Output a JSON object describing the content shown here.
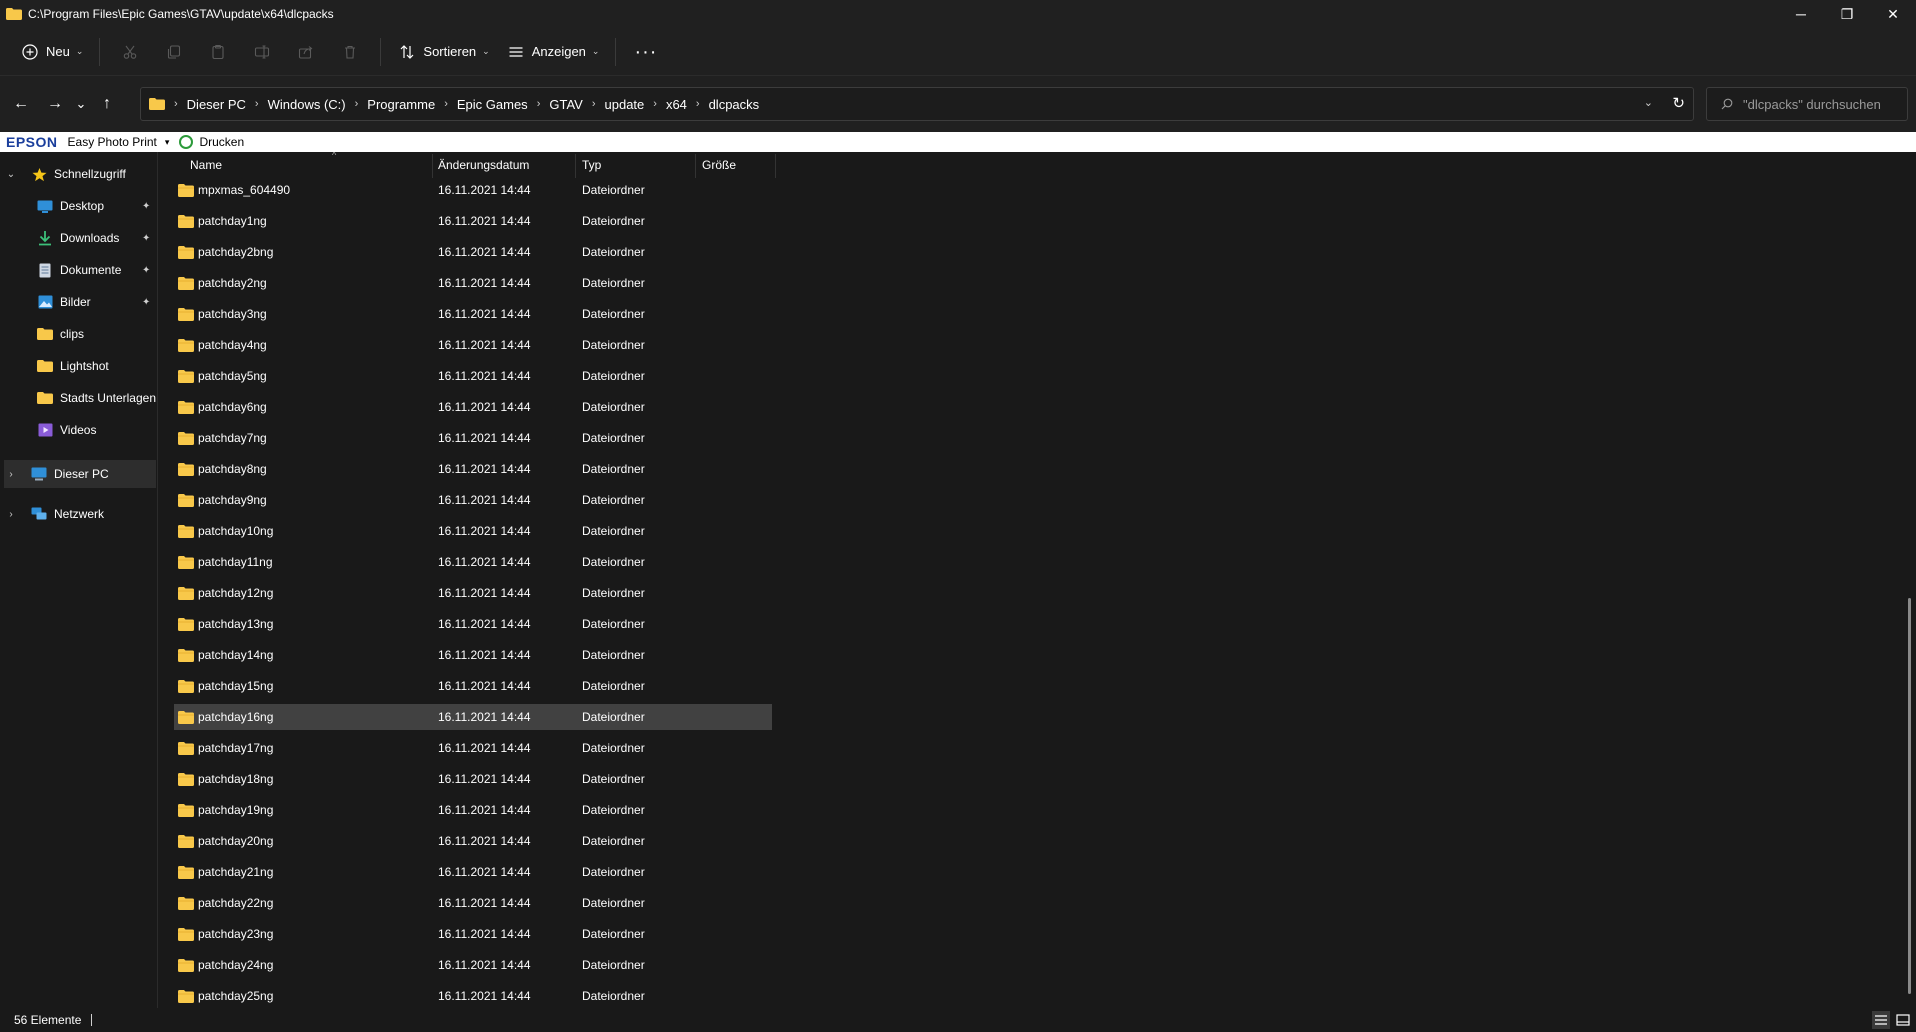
{
  "window": {
    "title": "C:\\Program Files\\Epic Games\\GTAV\\update\\x64\\dlcpacks",
    "minimize_glyph": "─",
    "restore_glyph": "❐",
    "close_glyph": "✕"
  },
  "commandbar": {
    "new_label": "Neu",
    "sort_label": "Sortieren",
    "view_label": "Anzeigen",
    "more_glyph": "···"
  },
  "nav": {
    "back_glyph": "←",
    "forward_glyph": "→",
    "recent_glyph": "⌄",
    "up_glyph": "↑"
  },
  "address": {
    "crumbs": [
      "Dieser PC",
      "Windows (C:)",
      "Programme",
      "Epic Games",
      "GTAV",
      "update",
      "x64",
      "dlcpacks"
    ],
    "separator": "›",
    "dropdown_glyph": "⌄",
    "refresh_glyph": "↻"
  },
  "search": {
    "placeholder": "\"dlcpacks\" durchsuchen"
  },
  "epson": {
    "logo": "EPSON",
    "app": "Easy Photo Print",
    "dropdown_glyph": "▾",
    "print_label": "Drucken"
  },
  "sidebar": {
    "quick_access": "Schnellzugriff",
    "items": [
      {
        "label": "Desktop",
        "icon": "desktop-icon",
        "pinned": true
      },
      {
        "label": "Downloads",
        "icon": "download-icon",
        "pinned": true
      },
      {
        "label": "Dokumente",
        "icon": "document-icon",
        "pinned": true
      },
      {
        "label": "Bilder",
        "icon": "pictures-icon",
        "pinned": true
      },
      {
        "label": "clips",
        "icon": "folder-icon",
        "pinned": false
      },
      {
        "label": "Lightshot",
        "icon": "folder-icon",
        "pinned": false
      },
      {
        "label": "Stadts Unterlagen",
        "icon": "folder-icon",
        "pinned": false
      },
      {
        "label": "Videos",
        "icon": "videos-icon",
        "pinned": false
      }
    ],
    "this_pc": "Dieser PC",
    "network": "Netzwerk",
    "pin_glyph": "📌",
    "expand_glyph": "›",
    "collapse_glyph": "⌄"
  },
  "columns": {
    "name": "Name",
    "date": "Änderungsdatum",
    "type": "Typ",
    "size": "Größe",
    "sort_glyph": "^"
  },
  "files": [
    {
      "name": "mpxmas_604490",
      "date": "16.11.2021 14:44",
      "type": "Dateiordner"
    },
    {
      "name": "patchday1ng",
      "date": "16.11.2021 14:44",
      "type": "Dateiordner"
    },
    {
      "name": "patchday2bng",
      "date": "16.11.2021 14:44",
      "type": "Dateiordner"
    },
    {
      "name": "patchday2ng",
      "date": "16.11.2021 14:44",
      "type": "Dateiordner"
    },
    {
      "name": "patchday3ng",
      "date": "16.11.2021 14:44",
      "type": "Dateiordner"
    },
    {
      "name": "patchday4ng",
      "date": "16.11.2021 14:44",
      "type": "Dateiordner"
    },
    {
      "name": "patchday5ng",
      "date": "16.11.2021 14:44",
      "type": "Dateiordner"
    },
    {
      "name": "patchday6ng",
      "date": "16.11.2021 14:44",
      "type": "Dateiordner"
    },
    {
      "name": "patchday7ng",
      "date": "16.11.2021 14:44",
      "type": "Dateiordner"
    },
    {
      "name": "patchday8ng",
      "date": "16.11.2021 14:44",
      "type": "Dateiordner"
    },
    {
      "name": "patchday9ng",
      "date": "16.11.2021 14:44",
      "type": "Dateiordner"
    },
    {
      "name": "patchday10ng",
      "date": "16.11.2021 14:44",
      "type": "Dateiordner"
    },
    {
      "name": "patchday11ng",
      "date": "16.11.2021 14:44",
      "type": "Dateiordner"
    },
    {
      "name": "patchday12ng",
      "date": "16.11.2021 14:44",
      "type": "Dateiordner"
    },
    {
      "name": "patchday13ng",
      "date": "16.11.2021 14:44",
      "type": "Dateiordner"
    },
    {
      "name": "patchday14ng",
      "date": "16.11.2021 14:44",
      "type": "Dateiordner"
    },
    {
      "name": "patchday15ng",
      "date": "16.11.2021 14:44",
      "type": "Dateiordner"
    },
    {
      "name": "patchday16ng",
      "date": "16.11.2021 14:44",
      "type": "Dateiordner",
      "selected": true
    },
    {
      "name": "patchday17ng",
      "date": "16.11.2021 14:44",
      "type": "Dateiordner"
    },
    {
      "name": "patchday18ng",
      "date": "16.11.2021 14:44",
      "type": "Dateiordner"
    },
    {
      "name": "patchday19ng",
      "date": "16.11.2021 14:44",
      "type": "Dateiordner"
    },
    {
      "name": "patchday20ng",
      "date": "16.11.2021 14:44",
      "type": "Dateiordner"
    },
    {
      "name": "patchday21ng",
      "date": "16.11.2021 14:44",
      "type": "Dateiordner"
    },
    {
      "name": "patchday22ng",
      "date": "16.11.2021 14:44",
      "type": "Dateiordner"
    },
    {
      "name": "patchday23ng",
      "date": "16.11.2021 14:44",
      "type": "Dateiordner"
    },
    {
      "name": "patchday24ng",
      "date": "16.11.2021 14:44",
      "type": "Dateiordner"
    },
    {
      "name": "patchday25ng",
      "date": "16.11.2021 14:44",
      "type": "Dateiordner"
    }
  ],
  "status": {
    "count": "56 Elemente"
  },
  "colors": {
    "background": "#191919",
    "chrome": "#202020",
    "selection": "#414141",
    "folder": "#f8c84a",
    "epson_blue": "#1a3e9c"
  }
}
